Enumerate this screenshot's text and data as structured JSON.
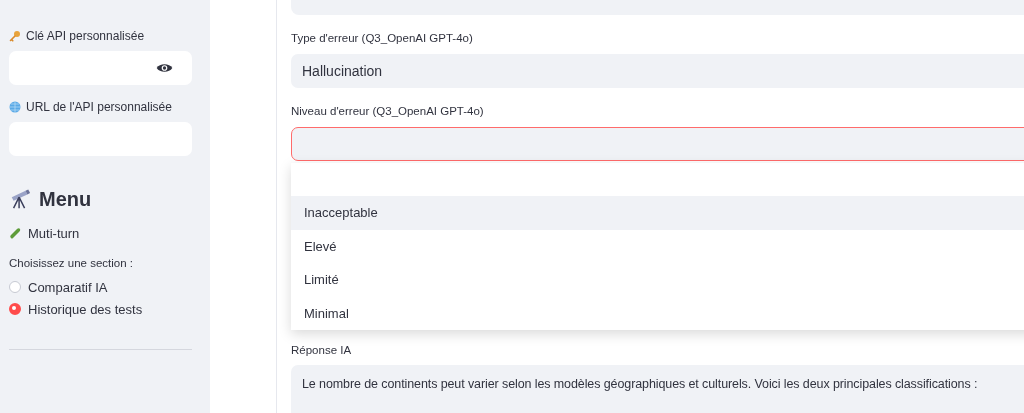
{
  "sidebar": {
    "api_key": {
      "label": "Clé API personnalisée"
    },
    "api_url": {
      "label": "URL de l'API personnalisée"
    },
    "menu_title": "Menu",
    "menu_link": "Muti-turn",
    "section_label": "Choisissez une section :",
    "sections": [
      {
        "label": "Comparatif IA",
        "selected": false
      },
      {
        "label": "Historique des tests",
        "selected": true
      }
    ]
  },
  "main": {
    "error_type": {
      "label": "Type d'erreur (Q3_OpenAI GPT-4o)",
      "value": "Hallucination"
    },
    "error_level": {
      "label": "Niveau d'erreur (Q3_OpenAI GPT-4o)",
      "invalid": true,
      "expanded": true,
      "options": [
        {
          "label": "Inacceptable",
          "selected": true
        },
        {
          "label": "Elevé",
          "selected": false
        },
        {
          "label": "Limité",
          "selected": false
        },
        {
          "label": "Minimal",
          "selected": false
        }
      ]
    },
    "response": {
      "label": "Réponse IA",
      "text": "Le nombre de continents peut varier selon les modèles géographiques et culturels. Voici les deux principales classifications :"
    }
  }
}
